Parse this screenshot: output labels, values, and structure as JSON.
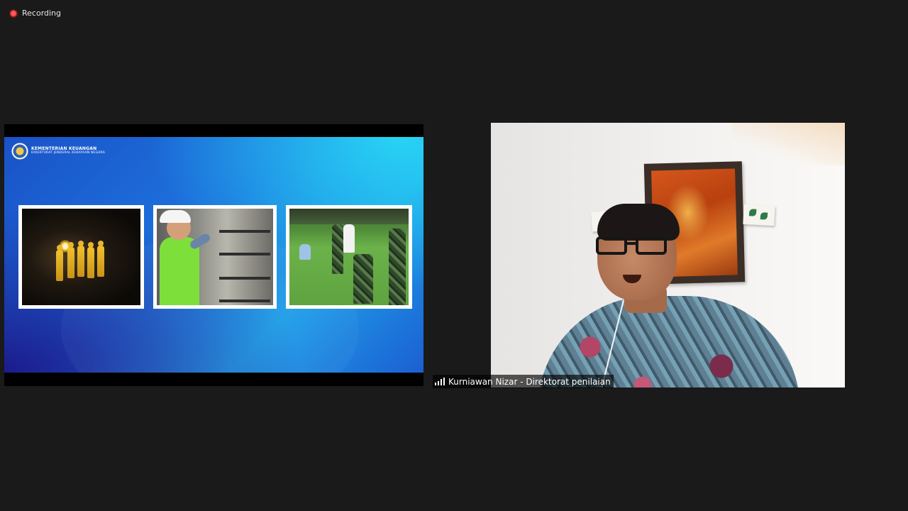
{
  "recording": {
    "label": "Recording",
    "icon": "recording-dot-icon"
  },
  "shared_screen": {
    "logo": {
      "line1": "KEMENTERIAN KEUANGAN",
      "line2": "DIREKTORAT JENDERAL KEKAYAAN NEGARA"
    },
    "photos": [
      {
        "subject": "mine-workers-photo"
      },
      {
        "subject": "technician-photo"
      },
      {
        "subject": "field-inspection-photo"
      }
    ]
  },
  "participant": {
    "name": "Kurniawan Nizar - Direktorat penilaian",
    "signal_icon": "signal-strength-icon"
  },
  "colors": {
    "background": "#1a1a1a",
    "recording_red": "#c9302c",
    "slide_blue": "#1d74de"
  }
}
